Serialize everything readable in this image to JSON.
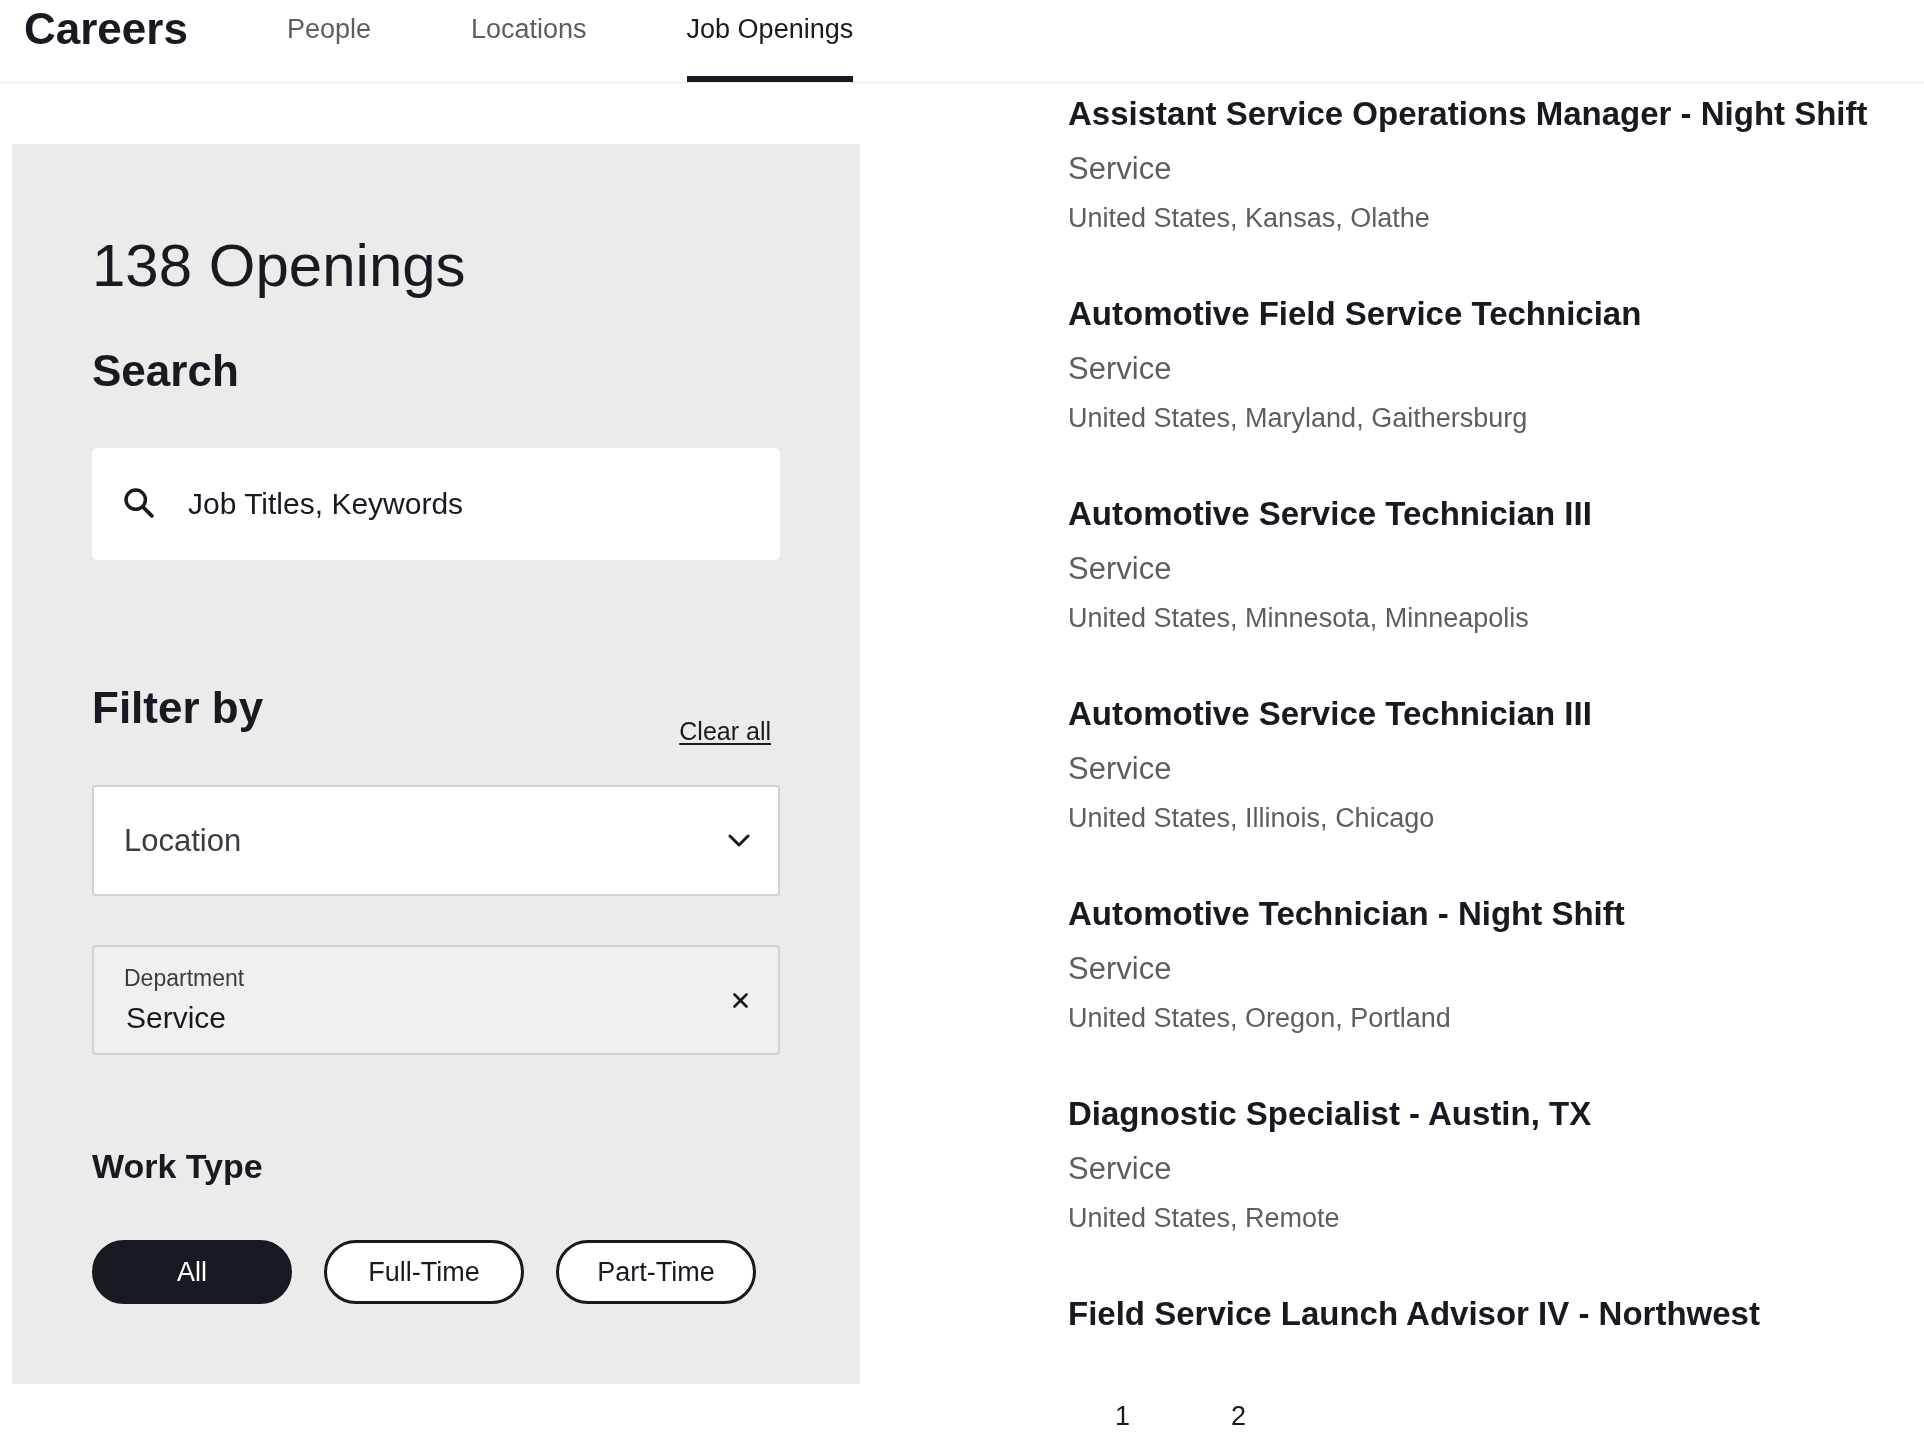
{
  "nav": {
    "logo": "Careers",
    "tabs": [
      {
        "label": "People",
        "selected": false
      },
      {
        "label": "Locations",
        "selected": false
      },
      {
        "label": "Job Openings",
        "selected": true
      }
    ]
  },
  "filters": {
    "count": "138 Openings",
    "search_heading": "Search",
    "search": {
      "placeholder": "Job Titles, Keywords"
    },
    "filter_heading": "Filter by",
    "clear_all": "Clear all",
    "location": {
      "label": "Location"
    },
    "department": {
      "label": "Department",
      "value": "Service"
    },
    "work_type": {
      "heading": "Work Type",
      "options": [
        {
          "label": "All",
          "selected": true
        },
        {
          "label": "Full-Time",
          "selected": false
        },
        {
          "label": "Part-Time",
          "selected": false
        }
      ]
    }
  },
  "jobs": [
    {
      "title": "Assistant Service Operations Manager - Night Shift",
      "department": "Service",
      "location": "United States, Kansas, Olathe"
    },
    {
      "title": "Automotive Field Service Technician",
      "department": "Service",
      "location": "United States, Maryland, Gaithersburg"
    },
    {
      "title": "Automotive Service Technician III",
      "department": "Service",
      "location": "United States, Minnesota, Minneapolis"
    },
    {
      "title": "Automotive Service Technician III",
      "department": "Service",
      "location": "United States, Illinois, Chicago"
    },
    {
      "title": "Automotive Technician - Night Shift",
      "department": "Service",
      "location": "United States, Oregon, Portland"
    },
    {
      "title": "Diagnostic Specialist - Austin, TX",
      "department": "Service",
      "location": "United States, Remote"
    },
    {
      "title": "Field Service Launch Advisor IV - Northwest"
    }
  ],
  "pagination": [
    {
      "label": "1"
    },
    {
      "label": "2"
    }
  ]
}
